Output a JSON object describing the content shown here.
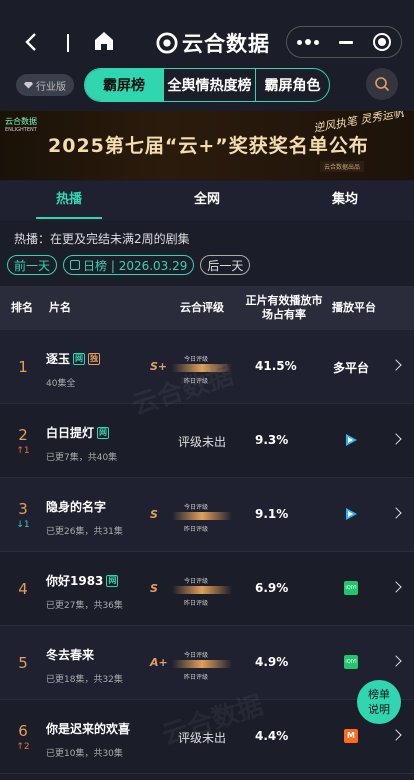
{
  "header": {
    "app_title": "云合数据"
  },
  "tabrow": {
    "industry_label": "行业版",
    "segments": [
      "霸屏榜",
      "全舆情热度榜",
      "霸屏角色"
    ]
  },
  "banner": {
    "title": "2025第七届“云+”奖获奖名单公布",
    "slogan": "逆风执笔 灵秀运帆",
    "sub": "云合数据出品",
    "corner": "云合数据",
    "corner_sub": "ENLIGHTENT"
  },
  "subtabs": [
    "热播",
    "全网",
    "集均"
  ],
  "note": "热播：在更及完结未满2周的剧集",
  "dates": {
    "prev": "前一天",
    "current": "日榜 | 2026.03.29",
    "next": "后一天"
  },
  "table": {
    "headers": {
      "rank": "排名",
      "name": "片名",
      "grade": "云合评级",
      "share": "正片有效播放市场占有率",
      "platform": "播放平台"
    },
    "grade_labels": {
      "today": "今日评级",
      "yesterday": "昨日评级"
    },
    "rows": [
      {
        "rank": "1",
        "trend": "",
        "name": "逐玉",
        "tag": "网",
        "tag2": "独",
        "eps": "40集全",
        "grade_letter": "S+",
        "grade_bar": "S+",
        "share": "41.5%",
        "platform": "多平台"
      },
      {
        "rank": "2",
        "trend": "↑1",
        "trend_dir": "up",
        "name": "白日提灯",
        "tag": "网",
        "eps": "已更7集，共40集",
        "grade_pending": "评级未出",
        "share": "9.3%",
        "platform_icon": "tencent-video-icon"
      },
      {
        "rank": "3",
        "trend": "↓1",
        "trend_dir": "down",
        "name": "隐身的名字",
        "eps": "已更26集，共31集",
        "grade_letter": "S",
        "grade_bar": "S",
        "share": "9.1%",
        "platform_icon": "tencent-video-icon"
      },
      {
        "rank": "4",
        "trend": "",
        "name": "你好1983",
        "tag": "网",
        "eps": "已更27集，共36集",
        "grade_letter": "S",
        "grade_bar": "S",
        "share": "6.9%",
        "platform_icon": "iqiyi-icon"
      },
      {
        "rank": "5",
        "trend": "",
        "name": "冬去春来",
        "eps": "已更18集，共32集",
        "grade_letter": "A+",
        "grade_bar": "A+",
        "share": "4.9%",
        "platform_icon": "iqiyi-icon"
      },
      {
        "rank": "6",
        "trend": "↑2",
        "trend_dir": "up",
        "name": "你是迟来的欢喜",
        "eps": "已更10集，共30集",
        "grade_pending": "评级未出",
        "share": "4.4%",
        "platform_icon": "mgtv-icon"
      }
    ]
  },
  "fab": {
    "line1": "榜单",
    "line2": "说明"
  },
  "platform_icon_text": {
    "iqiyi": "iQIYI",
    "mgtv": "M"
  },
  "colors": {
    "accent": "#2fd6b0",
    "gold": "#e0a05a",
    "up": "#f06d48"
  }
}
